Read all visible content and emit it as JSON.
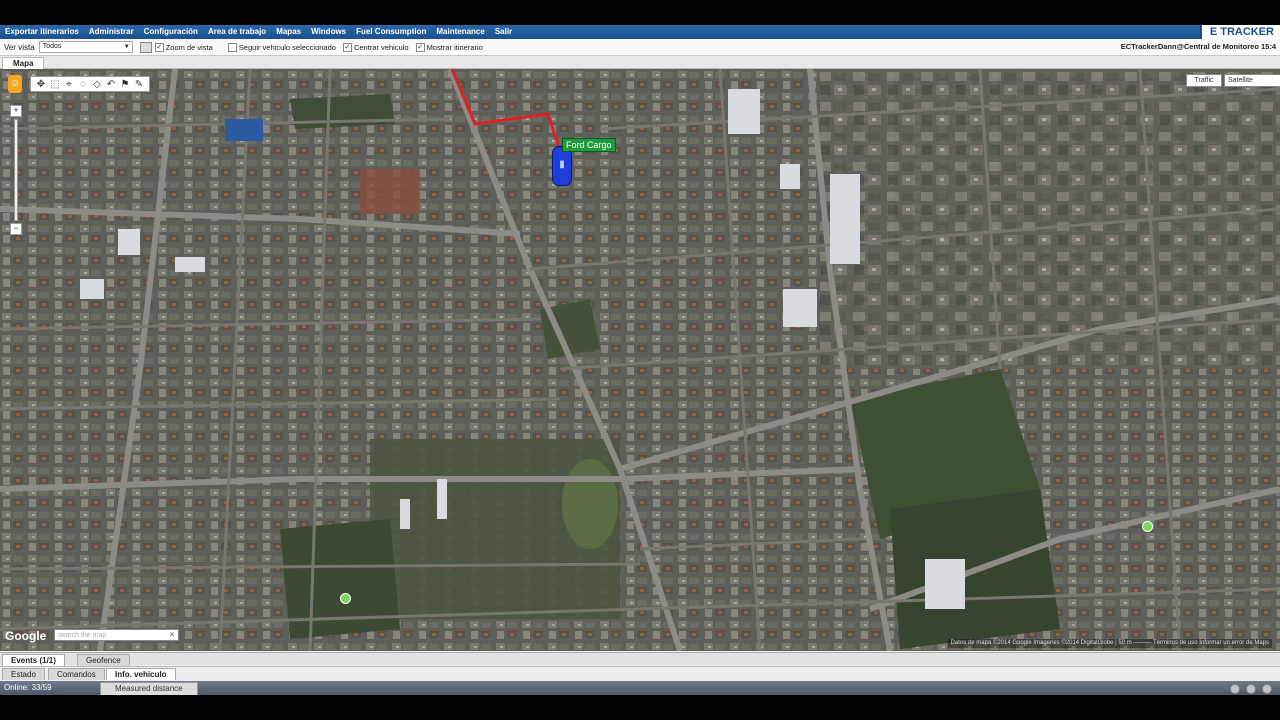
{
  "menu": {
    "items": [
      "Exportar itinerarios",
      "Administrar",
      "Configuración",
      "Area de trabajo",
      "Mapas",
      "Windows",
      "Fuel Consumption",
      "Maintenance",
      "Salir"
    ],
    "brand": "E TRACKER"
  },
  "toolbar": {
    "view_label": "Ver vista",
    "view_value": "Todos",
    "zoom_label": "Zoom de vista",
    "follow_label": "Seguir vehiculo seleccionado",
    "center_label": "Centrar vehiculo",
    "itinerary_label": "Mostrar itinerario",
    "zoom_checked": "✓",
    "follow_checked": "",
    "center_checked": "✓",
    "itinerary_checked": "✓",
    "user_info": "ECTrackerDann@Central de Monitoreo 15:4"
  },
  "map_tab": {
    "label": "Mapa"
  },
  "map": {
    "traffic_label": "Traffic",
    "map_type_value": "Satellite",
    "vehicle_label": "Ford Cargo",
    "google_logo": "Google",
    "search_placeholder": "search the map",
    "attribution": "Datos de mapa ©2014 Google Imágenes ©2014 DigitalGlobe | 50 m ———  Términos de uso  Informar un error de Maps"
  },
  "bottom": {
    "tabs_top": [
      "Events (1/1)",
      "Geofence"
    ],
    "tabs_bottom": [
      "Estado",
      "Comandos",
      "Info. vehiculo"
    ],
    "online": "Online: 33/59",
    "measured_distance": "Measured distance"
  }
}
